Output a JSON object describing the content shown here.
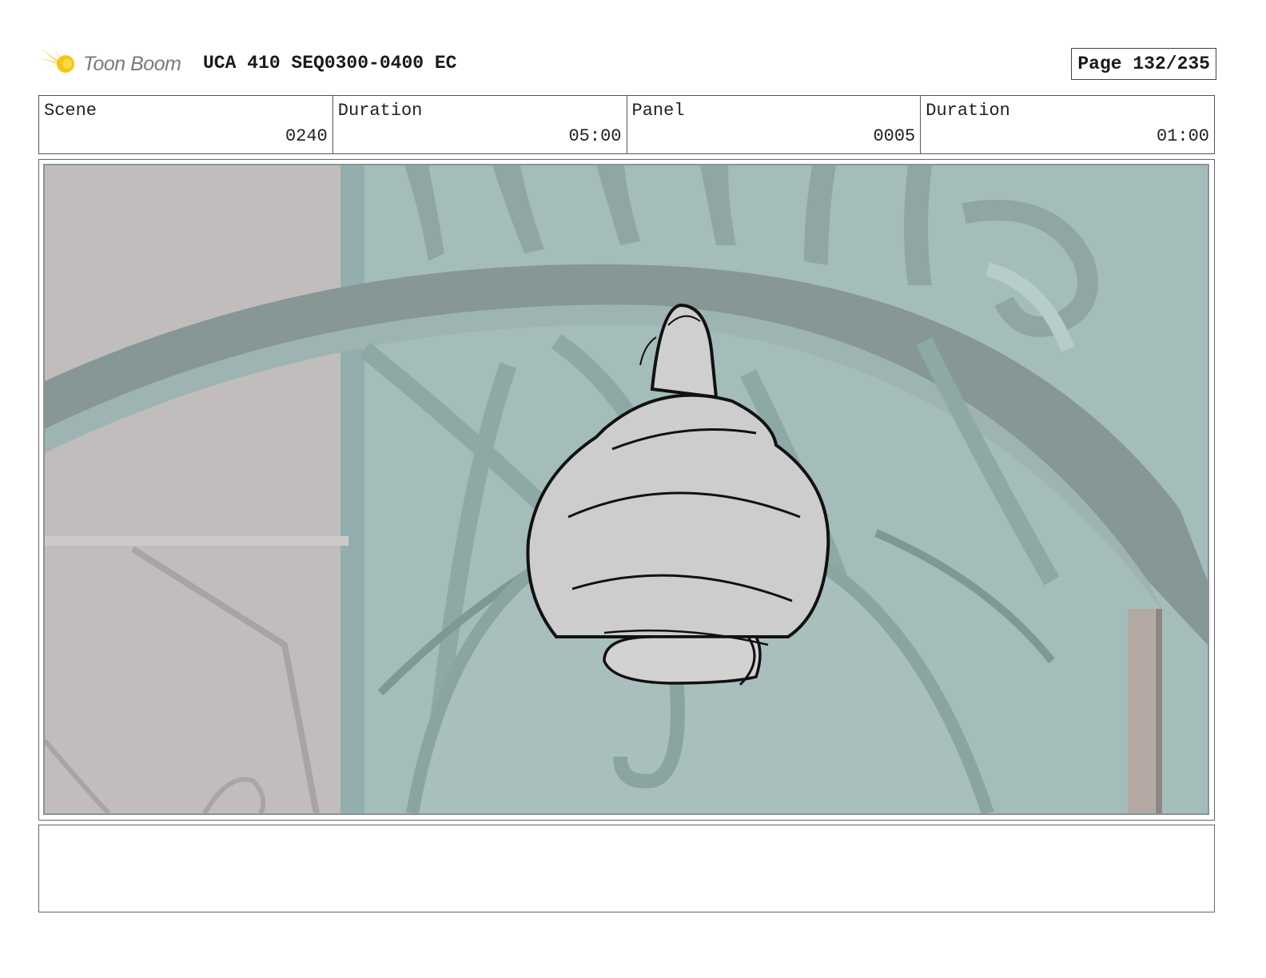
{
  "header": {
    "logo_text": "Toon Boom",
    "project_title": "UCA 410 SEQ0300-0400 EC",
    "page_label": "Page 132/235"
  },
  "info": {
    "scene_label": "Scene",
    "scene_value": "0240",
    "scene_duration_label": "Duration",
    "scene_duration_value": "05:00",
    "panel_label": "Panel",
    "panel_value": "0005",
    "panel_duration_label": "Duration",
    "panel_duration_value": "01:00"
  },
  "notes": {
    "text": ""
  },
  "colors": {
    "logo_accent": "#f5c518",
    "background_wall": "#bdb8b8",
    "ironwork_teal": "#9fbcbc",
    "lantern_fill": "#cfcfcf"
  }
}
